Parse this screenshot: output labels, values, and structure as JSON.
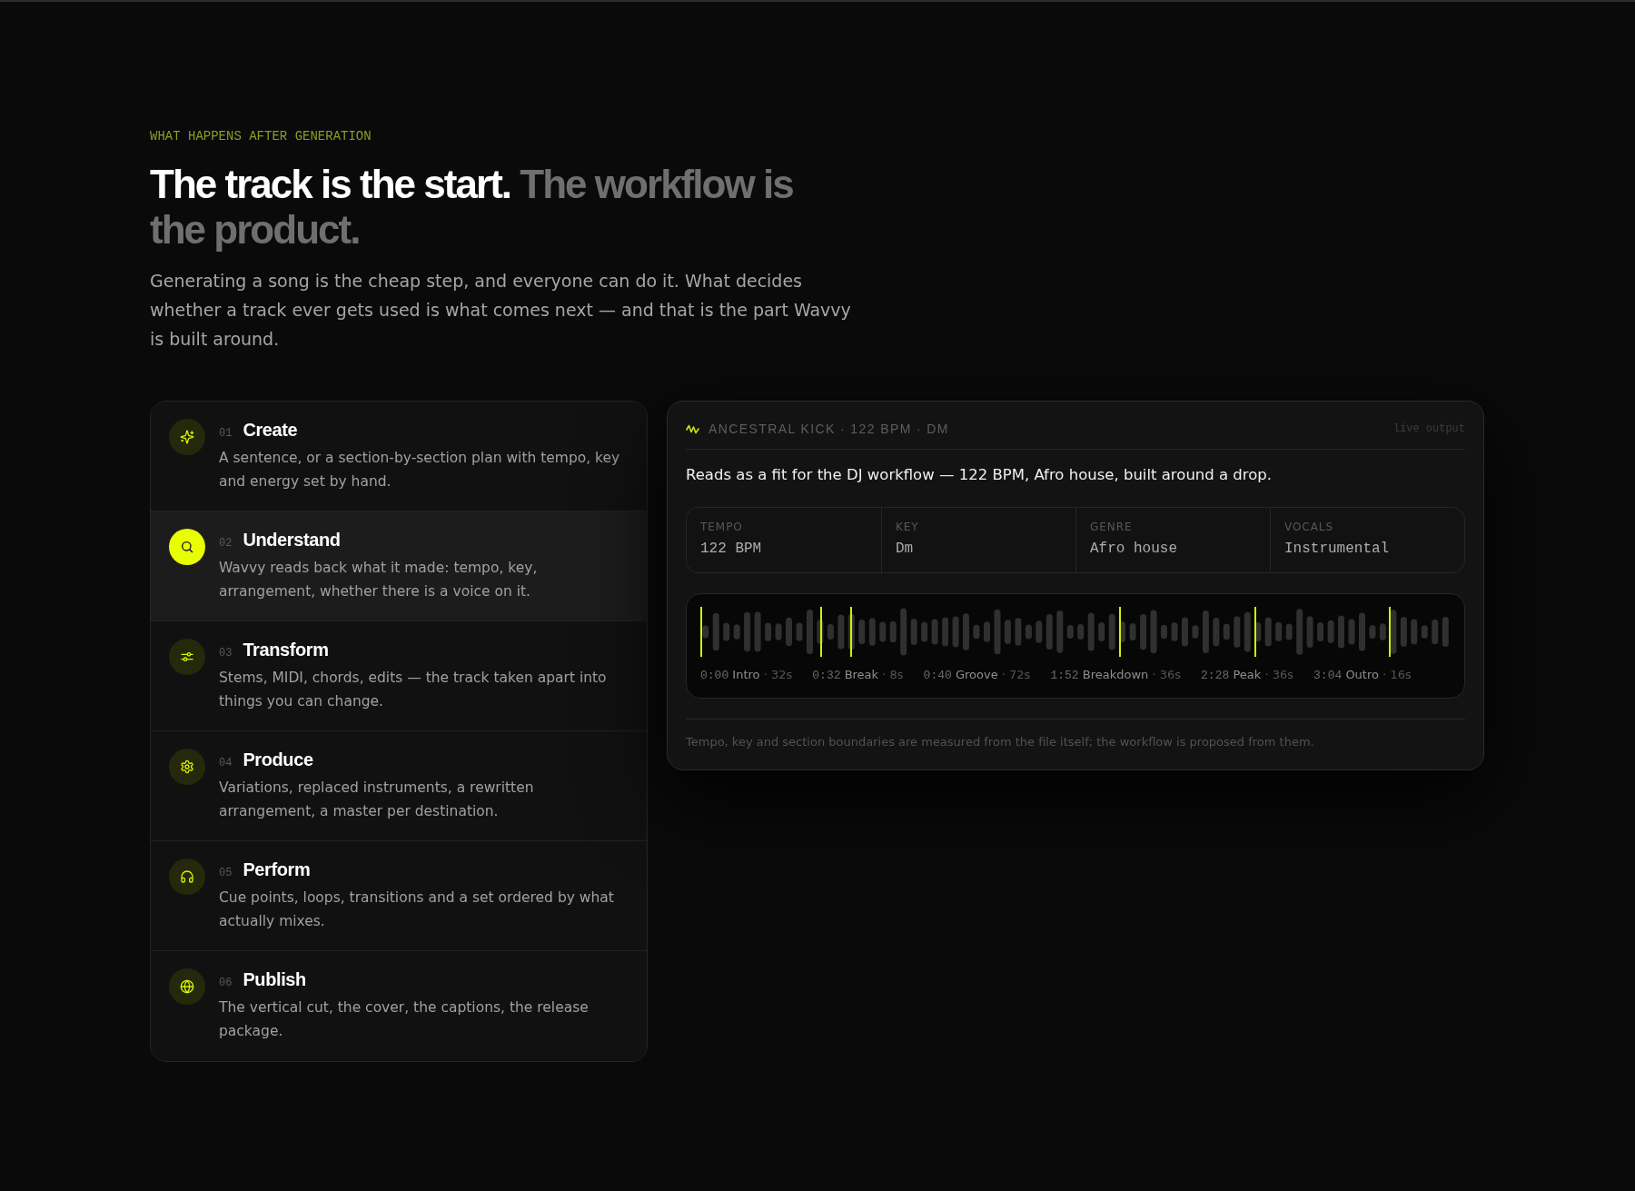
{
  "eyebrow": "WHAT HAPPENS AFTER GENERATION",
  "headline": {
    "lead": "The track is the start.",
    "rest": "The workflow is the product."
  },
  "intro": "Generating a song is the cheap step, and everyone can do it. What decides whether a track ever gets used is what comes next — and that is the part Wavvy is built around.",
  "steps": [
    {
      "number": "01",
      "title": "Create",
      "description": "A sentence, or a section-by-section plan with tempo, key and energy set by hand.",
      "selected": false
    },
    {
      "number": "02",
      "title": "Understand",
      "description": "Wavvy reads back what it made: tempo, key, arrangement, whether there is a voice on it.",
      "selected": true
    },
    {
      "number": "03",
      "title": "Transform",
      "description": "Stems, MIDI, chords, edits — the track taken apart into things you can change.",
      "selected": false
    },
    {
      "number": "04",
      "title": "Produce",
      "description": "Variations, replaced instruments, a rewritten arrangement, a master per destination.",
      "selected": false
    },
    {
      "number": "05",
      "title": "Perform",
      "description": "Cue points, loops, transitions and a set ordered by what actually mixes.",
      "selected": false
    },
    {
      "number": "06",
      "title": "Publish",
      "description": "The vertical cut, the cover, the captions, the release package.",
      "selected": false
    }
  ],
  "analysis": {
    "title": "ANCESTRAL KICK · 122 BPM · DM",
    "badge": "live output",
    "summary": "Reads as a fit for the DJ workflow — 122 BPM, Afro house, built around a drop.",
    "stats": [
      {
        "label": "TEMPO",
        "value": "122 BPM"
      },
      {
        "label": "KEY",
        "value": "Dm"
      },
      {
        "label": "GENRE",
        "value": "Afro house"
      },
      {
        "label": "VOCALS",
        "value": "Instrumental"
      }
    ],
    "sections": [
      {
        "time": "0:00",
        "name": "Intro",
        "length": "· 32s"
      },
      {
        "time": "0:32",
        "name": "Break",
        "length": "· 8s"
      },
      {
        "time": "0:40",
        "name": "Groove",
        "length": "· 72s"
      },
      {
        "time": "1:52",
        "name": "Breakdown",
        "length": "· 36s"
      },
      {
        "time": "2:28",
        "name": "Peak",
        "length": "· 36s"
      },
      {
        "time": "3:04",
        "name": "Outro",
        "length": "· 16s"
      }
    ],
    "note": "Tempo, key and section boundaries are measured from the file itself; the workflow is proposed from them."
  }
}
